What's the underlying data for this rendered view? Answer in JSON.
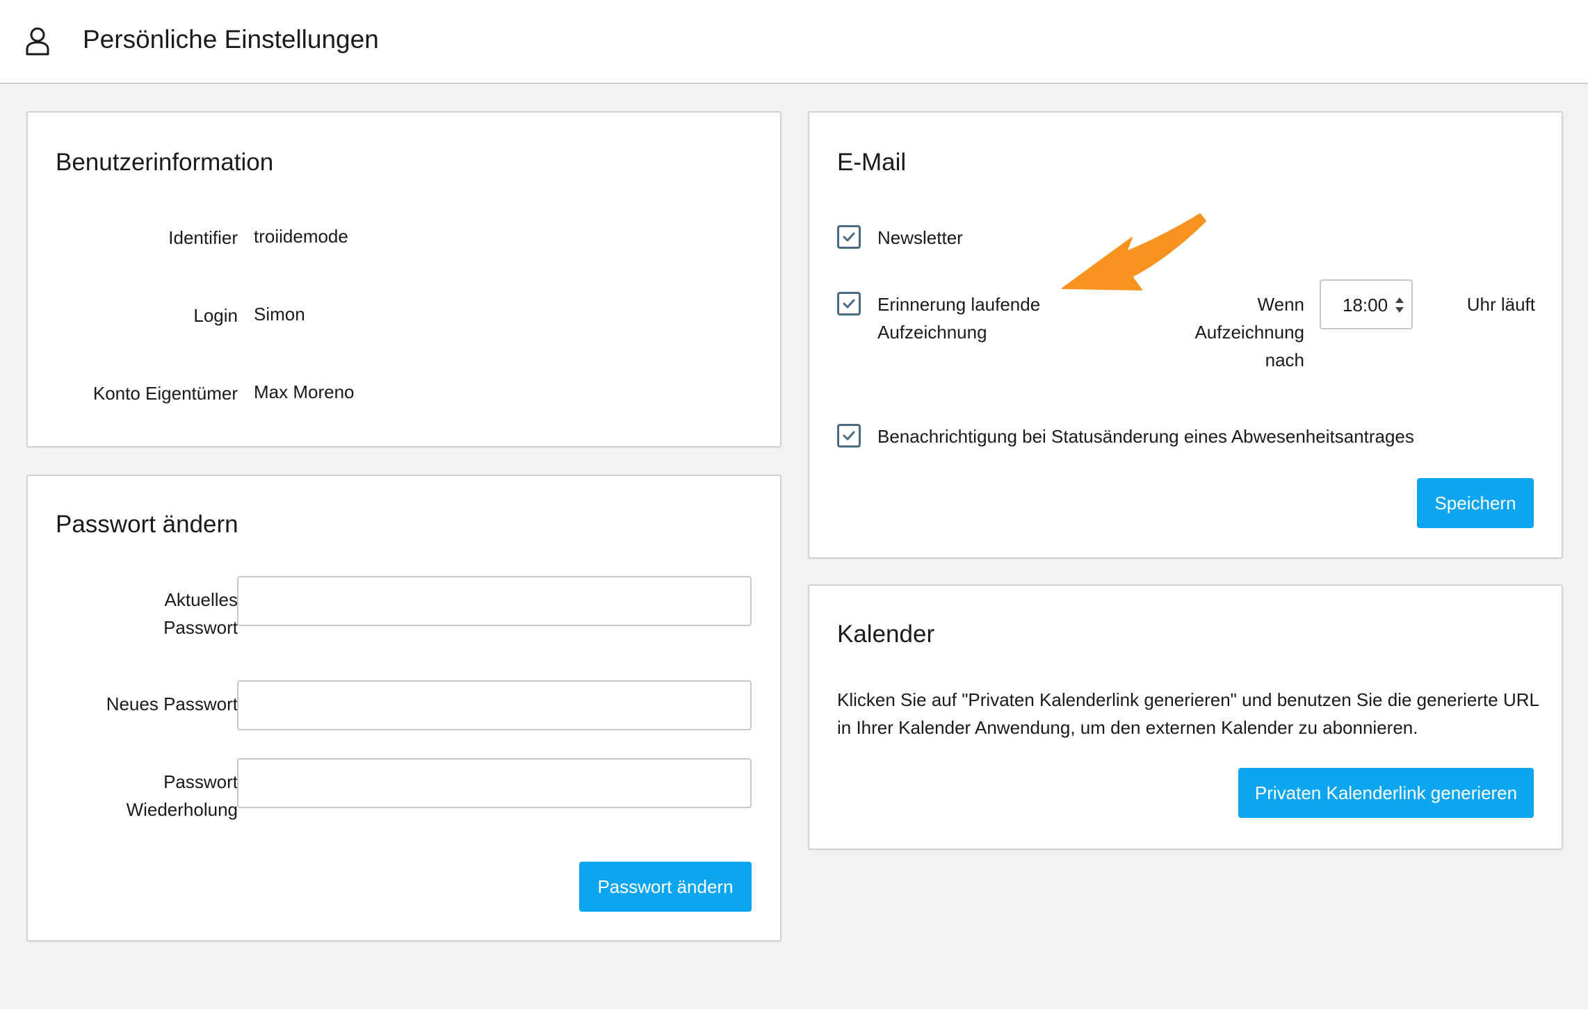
{
  "header": {
    "title": "Persönliche Einstellungen",
    "icon": "user-icon"
  },
  "user_info": {
    "title": "Benutzerinformation",
    "rows": [
      {
        "label": "Identifier",
        "value": "troiidemode"
      },
      {
        "label": "Login",
        "value": "Simon"
      },
      {
        "label": "Konto Eigentümer",
        "value": "Max Moreno"
      }
    ]
  },
  "password": {
    "title": "Passwort ändern",
    "current_label_1": "Aktuelles",
    "current_label_2": "Passwort",
    "new_label": "Neues Passwort",
    "repeat_label_1": "Passwort",
    "repeat_label_2": "Wiederholung",
    "current_value": "",
    "new_value": "",
    "repeat_value": "",
    "button": "Passwort ändern"
  },
  "email": {
    "title": "E-Mail",
    "newsletter": {
      "label": "Newsletter",
      "checked": true
    },
    "reminder": {
      "label_1": "Erinnerung laufende",
      "label_2": "Aufzeichnung",
      "checked": true,
      "when_1": "Wenn",
      "when_2": "Aufzeichnung",
      "when_3": "nach",
      "time": "18:00",
      "suffix": "Uhr läuft"
    },
    "absence": {
      "label": "Benachrichtigung bei Statusänderung eines Abwesenheitsantrages",
      "checked": true
    },
    "save_button": "Speichern"
  },
  "calendar": {
    "title": "Kalender",
    "text_1": "Klicken Sie auf \"Privaten Kalenderlink generieren\" und benutzen Sie die generierte URL",
    "text_2": "in Ihrer Kalender Anwendung, um den externen Kalender zu abonnieren.",
    "button": "Privaten Kalenderlink generieren"
  },
  "colors": {
    "accent": "#0ea5f0",
    "annotation_arrow": "#f7931e",
    "checkbox_border": "#4a6a80"
  }
}
